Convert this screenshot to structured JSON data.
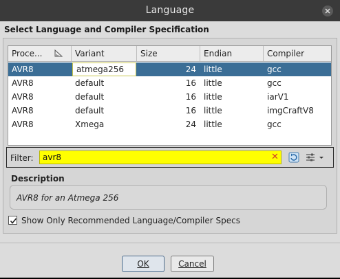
{
  "window": {
    "title": "Language",
    "close_label": "Close"
  },
  "heading": "Select Language and Compiler Specification",
  "table": {
    "columns": [
      "Proce...",
      "Variant",
      "Size",
      "Endian",
      "Compiler"
    ],
    "rows": [
      {
        "processor": "AVR8",
        "variant": "atmega256",
        "size": "24",
        "endian": "little",
        "compiler": "gcc",
        "selected": true
      },
      {
        "processor": "AVR8",
        "variant": "default",
        "size": "16",
        "endian": "little",
        "compiler": "gcc",
        "selected": false
      },
      {
        "processor": "AVR8",
        "variant": "default",
        "size": "16",
        "endian": "little",
        "compiler": "iarV1",
        "selected": false
      },
      {
        "processor": "AVR8",
        "variant": "default",
        "size": "16",
        "endian": "little",
        "compiler": "imgCraftV8",
        "selected": false
      },
      {
        "processor": "AVR8",
        "variant": "Xmega",
        "size": "24",
        "endian": "little",
        "compiler": "gcc",
        "selected": false
      }
    ]
  },
  "filter": {
    "label": "Filter:",
    "value": "avr8"
  },
  "description": {
    "heading": "Description",
    "text": "AVR8 for an Atmega 256"
  },
  "checkbox": {
    "label": "Show Only Recommended Language/Compiler Specs",
    "checked": true
  },
  "buttons": {
    "ok": "OK",
    "cancel": "Cancel"
  },
  "icons": {
    "close": "close-icon",
    "sort": "sort-ascending-icon",
    "clear": "clear-filter-icon",
    "refresh": "refresh-icon",
    "config": "filter-config-icon",
    "checkmark": "checkmark-icon"
  },
  "colors": {
    "selection": "#3b6e96",
    "filter_background": "#ffff00",
    "titlebar": "#3a3a3a"
  }
}
